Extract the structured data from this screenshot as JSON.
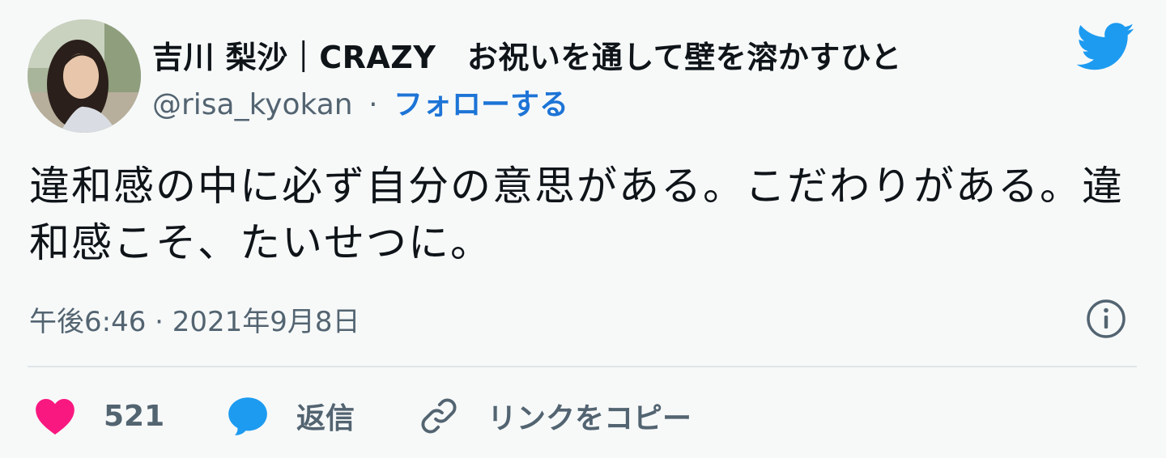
{
  "user": {
    "display_name": "吉川 梨沙｜CRAZY　お祝いを通して壁を溶かすひと",
    "handle": "@risa_kyokan",
    "separator": "·",
    "follow_label": "フォローする"
  },
  "tweet": {
    "text": "違和感の中に必ず自分の意思がある。こだわりがある。違和感こそ、たいせつに。",
    "timestamp": "午後6:46 · 2021年9月8日"
  },
  "actions": {
    "like_count": "521",
    "reply_label": "返信",
    "copy_link_label": "リンクをコピー"
  },
  "colors": {
    "twitter_blue": "#1d9bf0",
    "follow_link": "#1d74d6",
    "like_pink": "#f91880",
    "reply_blue": "#1d9bf0",
    "muted_text": "#536471",
    "background": "#f7f9f9"
  },
  "icons": {
    "logo": "twitter-bird-icon",
    "info": "info-icon",
    "like": "heart-icon",
    "reply": "speech-bubble-icon",
    "copy": "link-icon"
  }
}
